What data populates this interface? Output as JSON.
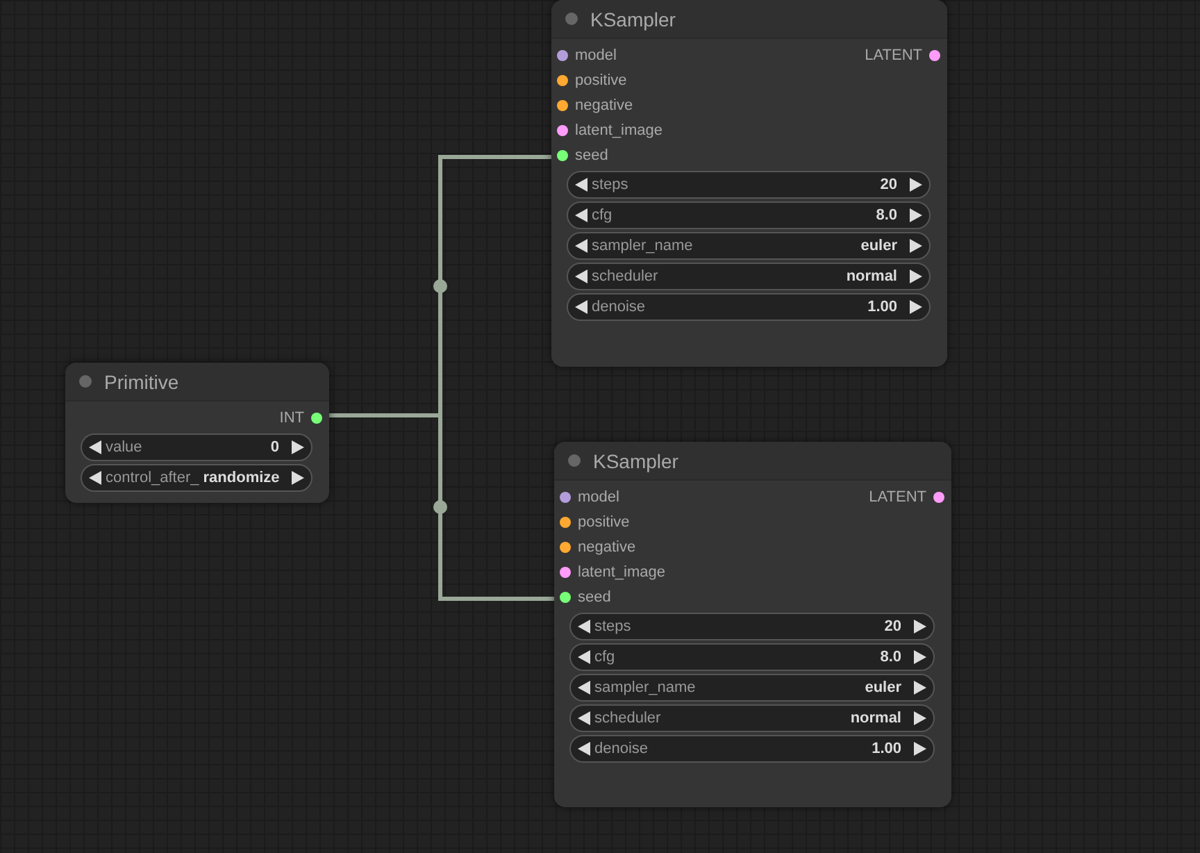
{
  "nodes": [
    {
      "title": "KSampler",
      "inputs": [
        {
          "name": "model",
          "color": "#b39ddb"
        },
        {
          "name": "positive",
          "color": "#ffa931"
        },
        {
          "name": "negative",
          "color": "#ffa931"
        },
        {
          "name": "latent_image",
          "color": "#ff9cf9"
        },
        {
          "name": "seed",
          "color": "#77ff77"
        }
      ],
      "outputs": [
        {
          "name": "LATENT",
          "color": "#ff9cf9"
        }
      ],
      "widgets": [
        {
          "label": "steps",
          "value": "20"
        },
        {
          "label": "cfg",
          "value": "8.0"
        },
        {
          "label": "sampler_name",
          "value": "euler"
        },
        {
          "label": "scheduler",
          "value": "normal"
        },
        {
          "label": "denoise",
          "value": "1.00"
        }
      ]
    },
    {
      "title": "Primitive",
      "outputs": [
        {
          "name": "INT",
          "color": "#77ff77"
        }
      ],
      "widgets": [
        {
          "label": "value",
          "value": "0"
        },
        {
          "label": "control_after_",
          "value": "randomize"
        }
      ]
    },
    {
      "title": "KSampler",
      "inputs": [
        {
          "name": "model",
          "color": "#b39ddb"
        },
        {
          "name": "positive",
          "color": "#ffa931"
        },
        {
          "name": "negative",
          "color": "#ffa931"
        },
        {
          "name": "latent_image",
          "color": "#ff9cf9"
        },
        {
          "name": "seed",
          "color": "#77ff77"
        }
      ],
      "outputs": [
        {
          "name": "LATENT",
          "color": "#ff9cf9"
        }
      ],
      "widgets": [
        {
          "label": "steps",
          "value": "20"
        },
        {
          "label": "cfg",
          "value": "8.0"
        },
        {
          "label": "sampler_name",
          "value": "euler"
        },
        {
          "label": "scheduler",
          "value": "normal"
        },
        {
          "label": "denoise",
          "value": "1.00"
        }
      ]
    }
  ]
}
